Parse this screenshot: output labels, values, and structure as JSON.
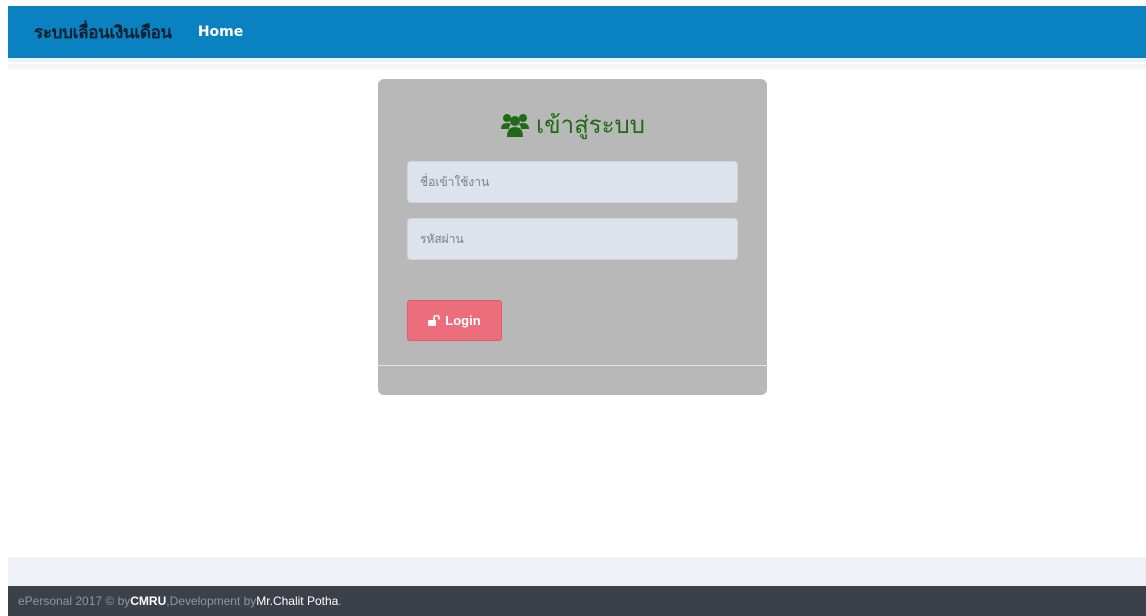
{
  "navbar": {
    "brand": "ระบบเลื่อนเงินเดือน",
    "home_label": "Home",
    "bg_color": "#0a82c2"
  },
  "login": {
    "title_icon": "users-icon",
    "title": "เข้าสู่ระบบ",
    "username_placeholder": "ชื่อเข้าใช้งาน",
    "password_placeholder": "รหัสผ่าน",
    "button_icon": "unlock-icon",
    "button_label": "Login",
    "button_color": "#ec6e7c",
    "title_color": "#1f6a14"
  },
  "footer": {
    "prefix": "ePersonal 2017 © by ",
    "org": "CMRU",
    "middle": " ,Development by ",
    "author": "Mr.Chalit Potha",
    "suffix": "."
  }
}
